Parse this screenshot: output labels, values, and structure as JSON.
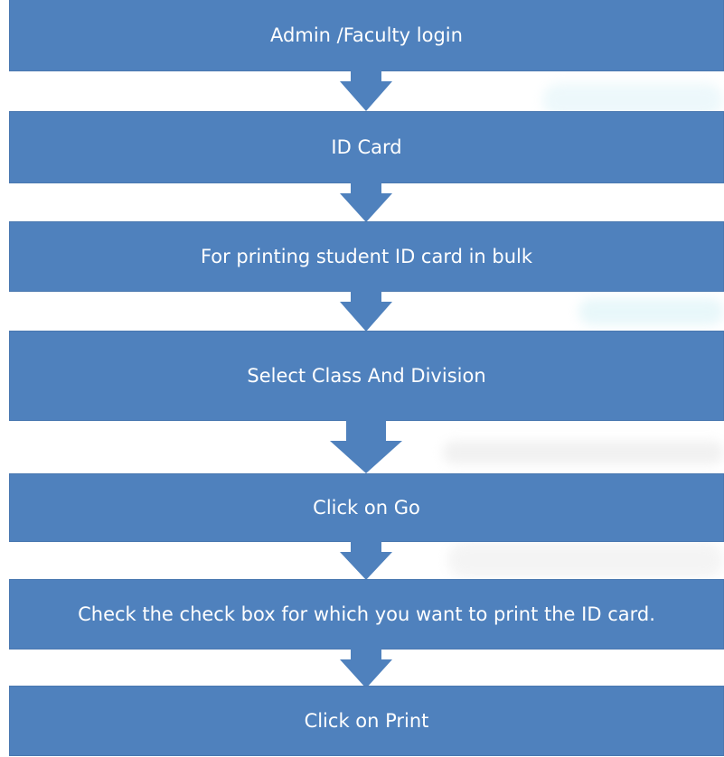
{
  "flowchart": {
    "steps": [
      {
        "label": "Admin /Faculty login"
      },
      {
        "label": "ID Card"
      },
      {
        "label": "For printing student ID card in bulk"
      },
      {
        "label": "Select Class And Division"
      },
      {
        "label": "Click on Go"
      },
      {
        "label": "Check the check box for which you want to print the ID card."
      },
      {
        "label": "Click on Print"
      }
    ]
  },
  "colors": {
    "box_fill": "#4f81bd",
    "arrow_fill": "#4f81bd",
    "text": "#ffffff"
  }
}
